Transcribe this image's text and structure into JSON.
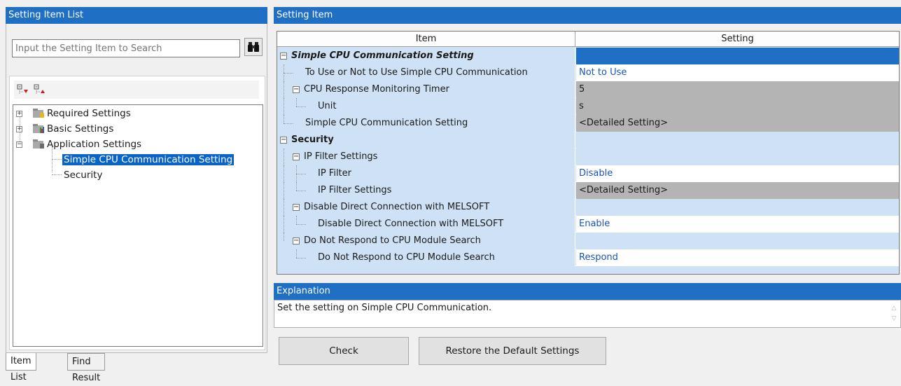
{
  "left_panel": {
    "title": "Setting Item List",
    "search": {
      "placeholder": "Input the Setting Item to Search",
      "value": ""
    },
    "tree": [
      {
        "label": "Required Settings",
        "expander": "+"
      },
      {
        "label": "Basic Settings",
        "expander": "+"
      },
      {
        "label": "Application Settings",
        "expander": "−"
      },
      {
        "label": "Simple CPU Communication Setting",
        "selected": true
      },
      {
        "label": "Security"
      }
    ],
    "tabs": [
      "Item List",
      "Find Result"
    ]
  },
  "right_panel": {
    "title": "Setting Item",
    "columns": {
      "item": "Item",
      "setting": "Setting"
    },
    "rows": [
      {
        "item": "Simple CPU Communication Setting",
        "value": "",
        "style": "section-italic",
        "vstyle": "sel"
      },
      {
        "item": "To Use or Not to Use Simple CPU Communication",
        "value": "Not to Use",
        "vstyle": "blue"
      },
      {
        "item": "CPU Response Monitoring Timer",
        "value": "5",
        "vstyle": "gray"
      },
      {
        "item": "Unit",
        "value": "s",
        "vstyle": "gray"
      },
      {
        "item": "Simple CPU Communication Setting",
        "value": "<Detailed Setting>",
        "vstyle": "gray"
      },
      {
        "item": "Security",
        "value": "",
        "style": "section",
        "vstyle": "light"
      },
      {
        "item": "IP Filter Settings",
        "value": "",
        "vstyle": "light"
      },
      {
        "item": "IP Filter",
        "value": "Disable",
        "vstyle": "blue"
      },
      {
        "item": "IP Filter Settings",
        "value": "<Detailed Setting>",
        "vstyle": "gray"
      },
      {
        "item": "Disable Direct Connection with MELSOFT",
        "value": "",
        "vstyle": "light"
      },
      {
        "item": "Disable Direct Connection with MELSOFT",
        "value": "Enable",
        "vstyle": "blue"
      },
      {
        "item": "Do Not Respond to CPU Module Search",
        "value": "",
        "vstyle": "light"
      },
      {
        "item": "Do Not Respond to CPU Module Search",
        "value": "Respond",
        "vstyle": "blue"
      }
    ]
  },
  "explanation": {
    "title": "Explanation",
    "text": "Set the setting on Simple CPU Communication."
  },
  "buttons": {
    "check": "Check",
    "restore": "Restore the Default Settings"
  },
  "colors": {
    "header_blue": "#1f6fc5",
    "value_blue": "#1a54b8",
    "row_light": "#cfe2f5",
    "row_gray": "#b4b4b4"
  }
}
